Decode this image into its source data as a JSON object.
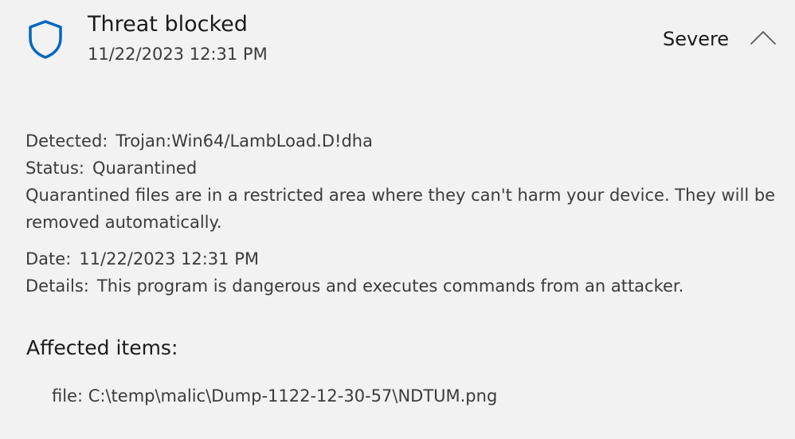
{
  "header": {
    "title": "Threat blocked",
    "timestamp": "11/22/2023 12:31 PM",
    "severity": "Severe",
    "icon": "shield-icon",
    "collapse_icon": "chevron-up-icon",
    "accent_color": "#0067c0"
  },
  "details": {
    "detected_label": "Detected:",
    "detected_value": "Trojan:Win64/LambLoad.D!dha",
    "status_label": "Status:",
    "status_value": "Quarantined",
    "status_description": "Quarantined files are in a restricted area where they can't harm your device. They will be removed automatically.",
    "date_label": "Date:",
    "date_value": "11/22/2023 12:31 PM",
    "details_label": "Details:",
    "details_value": "This program is dangerous and executes commands from an attacker."
  },
  "affected": {
    "title": "Affected items:",
    "items": [
      "file: C:\\temp\\malic\\Dump-1122-12-30-57\\NDTUM.png"
    ]
  }
}
